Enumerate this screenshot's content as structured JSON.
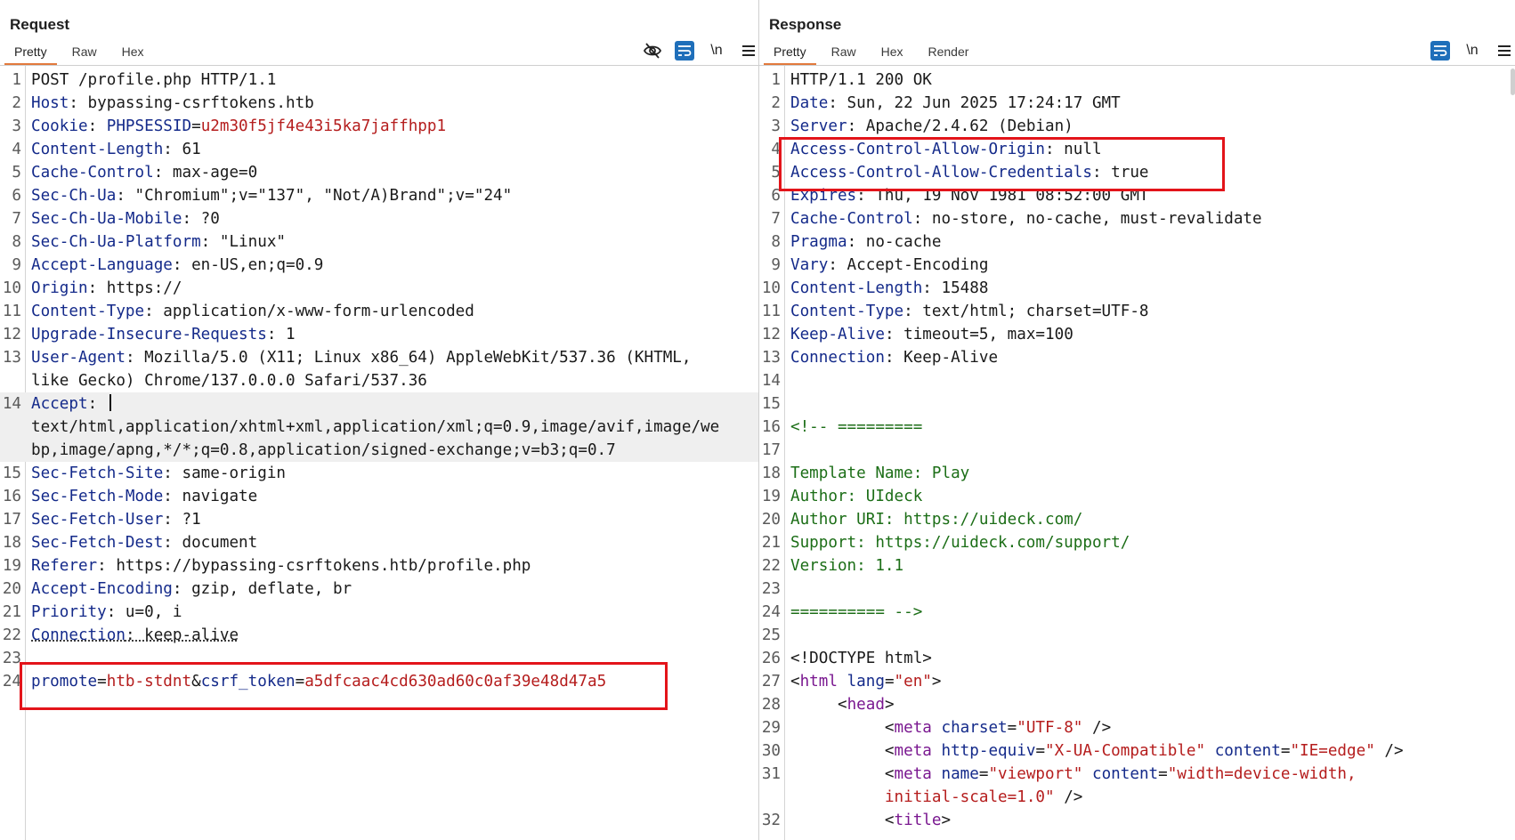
{
  "request": {
    "title": "Request",
    "tabs": [
      "Pretty",
      "Raw",
      "Hex"
    ],
    "active_tab": "Pretty",
    "tools": {
      "hide_icon": "eye-slash-icon",
      "wrap_icon": "word-wrap-icon",
      "newline_label": "\\n",
      "menu_icon": "hamburger-menu-icon"
    },
    "lines": [
      {
        "n": "1",
        "parts": [
          [
            "POST /profile.php HTTP/1.1",
            ""
          ]
        ]
      },
      {
        "n": "2",
        "parts": [
          [
            "Host",
            "k"
          ],
          [
            ": bypassing-csrftokens.htb",
            ""
          ]
        ]
      },
      {
        "n": "3",
        "parts": [
          [
            "Cookie",
            "k"
          ],
          [
            ": ",
            ""
          ],
          [
            "PHPSESSID",
            "k"
          ],
          [
            "=",
            ""
          ],
          [
            "u2m30f5jf4e43i5ka7jaffhpp1",
            "v"
          ]
        ]
      },
      {
        "n": "4",
        "parts": [
          [
            "Content-Length",
            "k"
          ],
          [
            ": 61",
            ""
          ]
        ]
      },
      {
        "n": "5",
        "parts": [
          [
            "Cache-Control",
            "k"
          ],
          [
            ": max-age=0",
            ""
          ]
        ]
      },
      {
        "n": "6",
        "parts": [
          [
            "Sec-Ch-Ua",
            "k"
          ],
          [
            ": \"Chromium\";v=\"137\", \"Not/A)Brand\";v=\"24\"",
            ""
          ]
        ]
      },
      {
        "n": "7",
        "parts": [
          [
            "Sec-Ch-Ua-Mobile",
            "k"
          ],
          [
            ": ?0",
            ""
          ]
        ]
      },
      {
        "n": "8",
        "parts": [
          [
            "Sec-Ch-Ua-Platform",
            "k"
          ],
          [
            ": \"Linux\"",
            ""
          ]
        ]
      },
      {
        "n": "9",
        "parts": [
          [
            "Accept-Language",
            "k"
          ],
          [
            ": en-US,en;q=0.9",
            ""
          ]
        ]
      },
      {
        "n": "10",
        "parts": [
          [
            "Origin",
            "k"
          ],
          [
            ": https://",
            ""
          ]
        ]
      },
      {
        "n": "11",
        "parts": [
          [
            "Content-Type",
            "k"
          ],
          [
            ": application/x-www-form-urlencoded",
            ""
          ]
        ]
      },
      {
        "n": "12",
        "parts": [
          [
            "Upgrade-Insecure-Requests",
            "k"
          ],
          [
            ": 1",
            ""
          ]
        ]
      },
      {
        "n": "13",
        "parts": [
          [
            "User-Agent",
            "k"
          ],
          [
            ": Mozilla/5.0 (X11; Linux x86_64) AppleWebKit/537.36 (KHTML,",
            ""
          ]
        ]
      },
      {
        "n": "",
        "parts": [
          [
            "like Gecko) Chrome/137.0.0.0 Safari/537.36",
            ""
          ]
        ]
      },
      {
        "n": "14",
        "cur": true,
        "caret": true,
        "parts": [
          [
            "Accept",
            "k"
          ],
          [
            ": ",
            ""
          ]
        ]
      },
      {
        "n": "",
        "cur": true,
        "parts": [
          [
            "text/html,application/xhtml+xml,application/xml;q=0.9,image/avif,image/we",
            ""
          ]
        ]
      },
      {
        "n": "",
        "cur": true,
        "parts": [
          [
            "bp,image/apng,*/*;q=0.8,application/signed-exchange;v=b3;q=0.7",
            ""
          ]
        ]
      },
      {
        "n": "15",
        "parts": [
          [
            "Sec-Fetch-Site",
            "k"
          ],
          [
            ": same-origin",
            ""
          ]
        ]
      },
      {
        "n": "16",
        "parts": [
          [
            "Sec-Fetch-Mode",
            "k"
          ],
          [
            ": navigate",
            ""
          ]
        ]
      },
      {
        "n": "17",
        "parts": [
          [
            "Sec-Fetch-User",
            "k"
          ],
          [
            ": ?1",
            ""
          ]
        ]
      },
      {
        "n": "18",
        "parts": [
          [
            "Sec-Fetch-Dest",
            "k"
          ],
          [
            ": document",
            ""
          ]
        ]
      },
      {
        "n": "19",
        "parts": [
          [
            "Referer",
            "k"
          ],
          [
            ": https://bypassing-csrftokens.htb/profile.php",
            ""
          ]
        ]
      },
      {
        "n": "20",
        "parts": [
          [
            "Accept-Encoding",
            "k"
          ],
          [
            ": gzip, deflate, br",
            ""
          ]
        ]
      },
      {
        "n": "21",
        "parts": [
          [
            "Priority",
            "k"
          ],
          [
            ": u=0, i",
            ""
          ]
        ]
      },
      {
        "n": "22",
        "parts": [
          [
            "Connection",
            "k dot"
          ],
          [
            ": keep-alive",
            "dot"
          ]
        ]
      },
      {
        "n": "23",
        "parts": []
      },
      {
        "n": "24",
        "parts": [
          [
            "promote",
            "k"
          ],
          [
            "=",
            ""
          ],
          [
            "htb-stdnt",
            "v"
          ],
          [
            "&",
            ""
          ],
          [
            "csrf_token",
            "k"
          ],
          [
            "=",
            ""
          ],
          [
            "a5dfcaac4cd630ad60c0af39e48d47a5",
            "v"
          ]
        ]
      }
    ]
  },
  "response": {
    "title": "Response",
    "tabs": [
      "Pretty",
      "Raw",
      "Hex",
      "Render"
    ],
    "active_tab": "Pretty",
    "tools": {
      "wrap_icon": "word-wrap-icon",
      "newline_label": "\\n",
      "menu_icon": "hamburger-menu-icon"
    },
    "lines": [
      {
        "n": "1",
        "parts": [
          [
            "HTTP/1.1 200 OK",
            ""
          ]
        ]
      },
      {
        "n": "2",
        "parts": [
          [
            "Date",
            "k"
          ],
          [
            ": Sun, 22 Jun 2025 17:24:17 GMT",
            ""
          ]
        ]
      },
      {
        "n": "3",
        "parts": [
          [
            "Server",
            "k"
          ],
          [
            ": Apache/2.4.62 (Debian)",
            ""
          ]
        ]
      },
      {
        "n": "4",
        "parts": [
          [
            "Access-Control-Allow-Origin",
            "k"
          ],
          [
            ": null",
            ""
          ]
        ]
      },
      {
        "n": "5",
        "parts": [
          [
            "Access-Control-Allow-Credentials",
            "k"
          ],
          [
            ": true",
            ""
          ]
        ]
      },
      {
        "n": "6",
        "parts": [
          [
            "Expires",
            "k"
          ],
          [
            ": Thu, 19 Nov 1981 08:52:00 GMT",
            ""
          ]
        ]
      },
      {
        "n": "7",
        "parts": [
          [
            "Cache-Control",
            "k"
          ],
          [
            ": no-store, no-cache, must-revalidate",
            ""
          ]
        ]
      },
      {
        "n": "8",
        "parts": [
          [
            "Pragma",
            "k"
          ],
          [
            ": no-cache",
            ""
          ]
        ]
      },
      {
        "n": "9",
        "parts": [
          [
            "Vary",
            "k"
          ],
          [
            ": Accept-Encoding",
            ""
          ]
        ]
      },
      {
        "n": "10",
        "parts": [
          [
            "Content-Length",
            "k"
          ],
          [
            ": 15488",
            ""
          ]
        ]
      },
      {
        "n": "11",
        "parts": [
          [
            "Content-Type",
            "k"
          ],
          [
            ": text/html; charset=UTF-8",
            ""
          ]
        ]
      },
      {
        "n": "12",
        "parts": [
          [
            "Keep-Alive",
            "k"
          ],
          [
            ": timeout=5, max=100",
            ""
          ]
        ]
      },
      {
        "n": "13",
        "parts": [
          [
            "Connection",
            "k"
          ],
          [
            ": Keep-Alive",
            ""
          ]
        ]
      },
      {
        "n": "14",
        "parts": []
      },
      {
        "n": "15",
        "parts": []
      },
      {
        "n": "16",
        "parts": [
          [
            "<!-- =========",
            "cm"
          ]
        ]
      },
      {
        "n": "17",
        "parts": []
      },
      {
        "n": "18",
        "parts": [
          [
            "Template Name: Play",
            "cm"
          ]
        ]
      },
      {
        "n": "19",
        "parts": [
          [
            "Author: UIdeck",
            "cm"
          ]
        ]
      },
      {
        "n": "20",
        "parts": [
          [
            "Author URI: https://uideck.com/",
            "cm"
          ]
        ]
      },
      {
        "n": "21",
        "parts": [
          [
            "Support: https://uideck.com/support/",
            "cm"
          ]
        ]
      },
      {
        "n": "22",
        "parts": [
          [
            "Version: 1.1",
            "cm"
          ]
        ]
      },
      {
        "n": "23",
        "parts": []
      },
      {
        "n": "24",
        "parts": [
          [
            "========== -->",
            "cm"
          ]
        ]
      },
      {
        "n": "25",
        "parts": []
      },
      {
        "n": "26",
        "parts": [
          [
            "<!DOCTYPE html>",
            ""
          ]
        ]
      },
      {
        "n": "27",
        "parts": [
          [
            "<",
            ""
          ],
          [
            "html",
            "tg"
          ],
          [
            " ",
            ""
          ],
          [
            "lang",
            "k"
          ],
          [
            "=",
            ""
          ],
          [
            "\"en\"",
            "v"
          ],
          [
            ">",
            ""
          ]
        ]
      },
      {
        "n": "28",
        "parts": [
          [
            "     <",
            ""
          ],
          [
            "head",
            "tg"
          ],
          [
            ">",
            ""
          ]
        ]
      },
      {
        "n": "29",
        "parts": [
          [
            "          <",
            ""
          ],
          [
            "meta",
            "tg"
          ],
          [
            " ",
            ""
          ],
          [
            "charset",
            "k"
          ],
          [
            "=",
            ""
          ],
          [
            "\"UTF-8\"",
            "v"
          ],
          [
            " />",
            ""
          ]
        ]
      },
      {
        "n": "30",
        "parts": [
          [
            "          <",
            ""
          ],
          [
            "meta",
            "tg"
          ],
          [
            " ",
            ""
          ],
          [
            "http-equiv",
            "k"
          ],
          [
            "=",
            ""
          ],
          [
            "\"X-UA-Compatible\"",
            "v"
          ],
          [
            " ",
            ""
          ],
          [
            "content",
            "k"
          ],
          [
            "=",
            ""
          ],
          [
            "\"IE=edge\"",
            "v"
          ],
          [
            " />",
            ""
          ]
        ]
      },
      {
        "n": "31",
        "parts": [
          [
            "          <",
            ""
          ],
          [
            "meta",
            "tg"
          ],
          [
            " ",
            ""
          ],
          [
            "name",
            "k"
          ],
          [
            "=",
            ""
          ],
          [
            "\"viewport\"",
            "v"
          ],
          [
            " ",
            ""
          ],
          [
            "content",
            "k"
          ],
          [
            "=",
            ""
          ],
          [
            "\"width=device-width,",
            "v"
          ]
        ]
      },
      {
        "n": "",
        "parts": [
          [
            "          ",
            ""
          ],
          [
            "initial-scale=1.0\"",
            "v"
          ],
          [
            " />",
            ""
          ]
        ]
      },
      {
        "n": "32",
        "parts": [
          [
            "          <",
            ""
          ],
          [
            "title",
            "tg"
          ],
          [
            ">",
            ""
          ]
        ]
      }
    ]
  }
}
